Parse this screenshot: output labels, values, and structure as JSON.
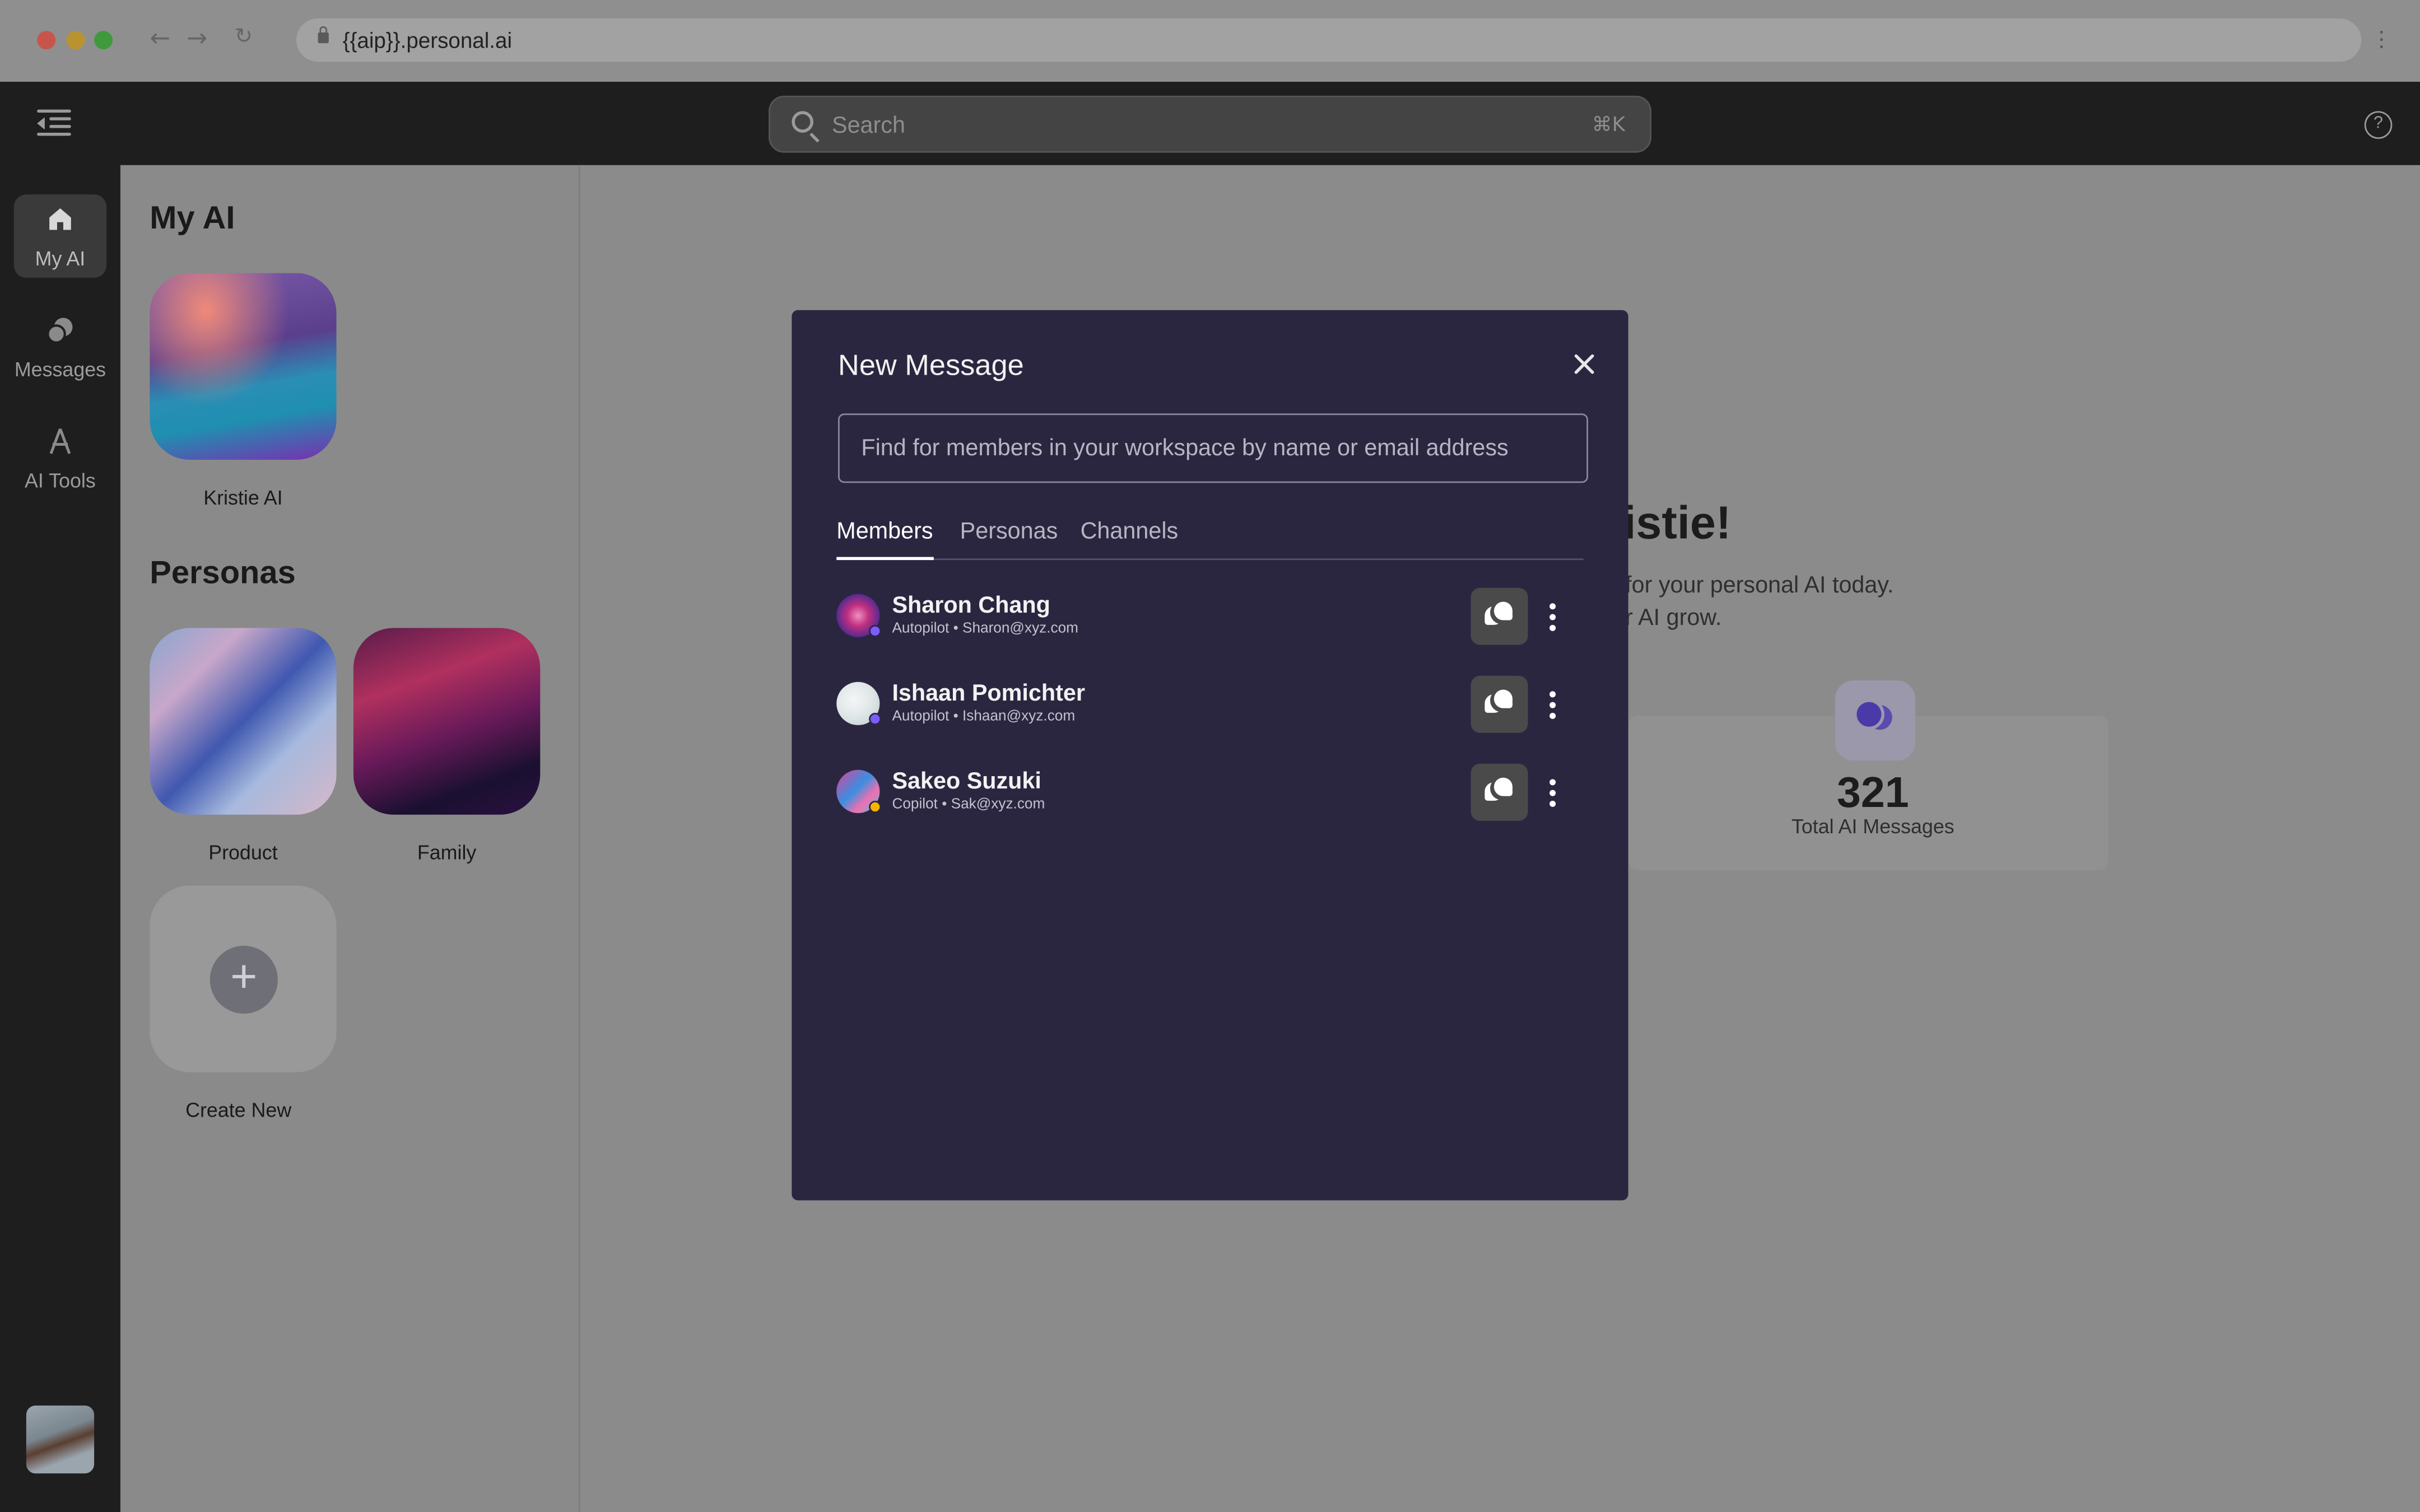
{
  "browser": {
    "url": "{{aip}}.personal.ai",
    "back_icon": "arrow-left-icon",
    "forward_icon": "arrow-right-icon",
    "reload_icon": "reload-icon",
    "menu_icon": "more-vertical-icon"
  },
  "topbar": {
    "search_placeholder": "Search",
    "search_shortcut": "⌘K",
    "help_glyph": "?"
  },
  "rail": {
    "items": [
      {
        "label": "My AI",
        "icon": "home-icon",
        "active": true
      },
      {
        "label": "Messages",
        "icon": "messages-icon",
        "active": false
      },
      {
        "label": "AI Tools",
        "icon": "ai-tools-icon",
        "active": false
      }
    ]
  },
  "panel": {
    "my_ai_heading": "My AI",
    "my_ai_name": "Kristie AI",
    "personas_heading": "Personas",
    "personas": [
      {
        "name": "Product"
      },
      {
        "name": "Family"
      }
    ],
    "create_new": "Create New",
    "create_glyph": "+"
  },
  "main": {
    "greeting": "ristie!",
    "subtitle_line1": "for your personal AI today.",
    "subtitle_line2": "r AI grow.",
    "stat_value": "321",
    "stat_label": "Total AI Messages"
  },
  "modal": {
    "title": "New Message",
    "input_placeholder": "Find for members in your workspace by name or email address",
    "tabs": [
      {
        "label": "Members",
        "active": true
      },
      {
        "label": "Personas",
        "active": false
      },
      {
        "label": "Channels",
        "active": false
      }
    ],
    "members": [
      {
        "name": "Sharon Chang",
        "meta": "Autopilot • Sharon@xyz.com",
        "status_color": "#7b5cff"
      },
      {
        "name": "Ishaan Pomichter",
        "meta": "Autopilot • Ishaan@xyz.com",
        "status_color": "#7b5cff"
      },
      {
        "name": "Sakeo Suzuki",
        "meta": "Copilot • Sak@xyz.com",
        "status_color": "#f5b400"
      }
    ]
  },
  "colors": {
    "modal_bg": "#2b2640",
    "accent_purple": "#7b5cff",
    "copilot_yellow": "#f5b400"
  }
}
